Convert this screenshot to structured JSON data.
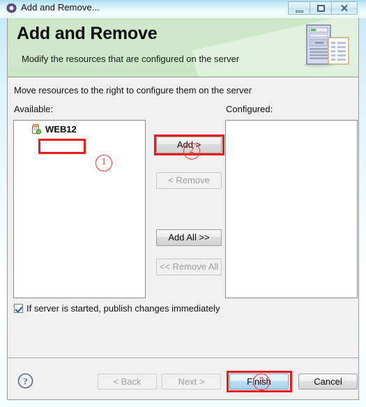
{
  "window": {
    "title": "Add and Remove...",
    "icon": "gear-icon",
    "controls": {
      "minimize_label": "Minimize",
      "maximize_label": "Maximize",
      "close_label": "✕"
    }
  },
  "banner": {
    "title": "Add and Remove",
    "subtitle": "Modify the resources that are configured on the server",
    "icon": "server-and-document-icon",
    "background_color": "#cde8c8"
  },
  "content": {
    "instruction": "Move resources to the right to configure them on the server",
    "available": {
      "label": "Available:",
      "items": [
        {
          "name": "WEB12",
          "icon": "web-project-icon"
        }
      ]
    },
    "configured": {
      "label": "Configured:",
      "items": []
    },
    "transfer_buttons": [
      {
        "label": "Add >",
        "enabled": true
      },
      {
        "label": "< Remove",
        "enabled": false
      },
      {
        "label": "Add All >>",
        "enabled": true
      },
      {
        "label": "<< Remove All",
        "enabled": false
      }
    ],
    "publish_option": {
      "label": "If server is started, publish changes immediately",
      "checked": true
    }
  },
  "footer": {
    "help_icon": "question-mark-icon",
    "buttons": [
      {
        "label": "< Back",
        "enabled": false
      },
      {
        "label": "Next >",
        "enabled": false
      },
      {
        "label": "Finish",
        "enabled": true,
        "default": true
      },
      {
        "label": "Cancel",
        "enabled": true
      }
    ]
  },
  "annotations": {
    "accent_color": "#ee1b1b",
    "markers": [
      {
        "id": "1",
        "glyph": "①",
        "target": "WEB12 list item"
      },
      {
        "id": "2",
        "glyph": "②",
        "target": "Add > button"
      },
      {
        "id": "3",
        "glyph": "③",
        "target": "Finish button"
      }
    ]
  }
}
